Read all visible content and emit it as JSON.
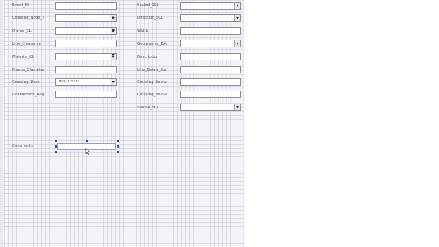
{
  "form": {
    "left_fields": [
      {
        "label": "Event_ID",
        "type": "text",
        "value": ""
      },
      {
        "label": "Crossing_Node_T",
        "type": "combo",
        "value": ""
      },
      {
        "label": "Owner_CL",
        "type": "combo",
        "value": ""
      },
      {
        "label": "Line_Clearance",
        "type": "text",
        "value": ""
      },
      {
        "label": "Material_CL",
        "type": "combo",
        "value": ""
      },
      {
        "label": "Flange_Diameter",
        "type": "text",
        "value": ""
      },
      {
        "label": "Crossing_Date",
        "type": "combo",
        "value": "06/10/2001"
      },
      {
        "label": "Intersection_Ang",
        "type": "text",
        "value": ""
      }
    ],
    "right_fields": [
      {
        "label": "Scaled_SCL",
        "type": "combo",
        "value": ""
      },
      {
        "label": "Direction_SCL",
        "type": "combo",
        "value": ""
      },
      {
        "label": "Width",
        "type": "text",
        "value": ""
      },
      {
        "label": "Geographic_Ext",
        "type": "combo",
        "value": ""
      },
      {
        "label": "Description",
        "type": "text",
        "value": ""
      },
      {
        "label": "Line_Below_Surf",
        "type": "text",
        "value": ""
      },
      {
        "label": "Crossing_Below",
        "type": "text",
        "value": ""
      },
      {
        "label": "Crossing_Below",
        "type": "text",
        "value": ""
      },
      {
        "label": "Source_SCL",
        "type": "combo",
        "value": ""
      }
    ],
    "comments": {
      "label": "Comments",
      "value": ""
    }
  }
}
